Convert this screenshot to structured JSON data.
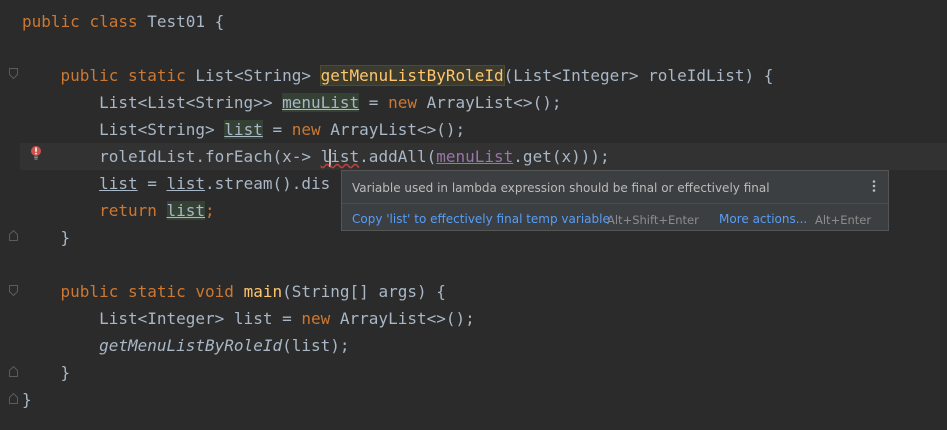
{
  "editor": {
    "lines": {
      "l1": {
        "kw1": "public",
        "kw2": "class",
        "name": "Test01 {"
      },
      "l3": {
        "kw1": "public",
        "kw2": "static",
        "ret": "List<String> ",
        "fn": "getMenuListByRoleId",
        "params": "(List<Integer> roleIdList) {"
      },
      "l4": {
        "type": "List<List<String>> ",
        "var": "menuList",
        "eq": " = ",
        "kw": "new",
        "rest": " ArrayList<>();"
      },
      "l5": {
        "type": "List<String> ",
        "var": "list",
        "eq": " = ",
        "kw": "new",
        "rest": " ArrayList<>();"
      },
      "l6": {
        "pre": "roleIdList.forEach(x-> ",
        "var_a": "l",
        "var_b": "ist",
        "mid": ".addAll(",
        "field": "menuList",
        "post": ".get(x)));"
      },
      "l7": {
        "var": "list",
        "eq": " = ",
        "var2": "list",
        "rest": ".stream().dis"
      },
      "l8": {
        "kw": "return",
        "sp": " ",
        "var": "list",
        "end": ";"
      },
      "l9": {
        "text": "}"
      },
      "l11": {
        "kw1": "public",
        "kw2": "static",
        "kw3": "void",
        "fn": "main",
        "params": "(String[] args) {"
      },
      "l12": {
        "type": "List<Integer> list = ",
        "kw": "new",
        "rest": " ArrayList<>();"
      },
      "l13": {
        "call": "getMenuListByRoleId",
        "args": "(list);"
      },
      "l14": {
        "text": "}"
      },
      "l15": {
        "text": "}"
      }
    }
  },
  "popup": {
    "message": "Variable used in lambda expression should be final or effectively final",
    "fix_label": "Copy 'list' to effectively final temp variable",
    "fix_shortcut": "Alt+Shift+Enter",
    "more_label": "More actions...",
    "more_shortcut": "Alt+Enter"
  },
  "icons": {
    "gutter_error": "bulb-error-icon",
    "fold": "fold-marker-icon",
    "menu": "kebab-menu-icon"
  },
  "colors": {
    "background": "#2b2b2b",
    "keyword": "#cc7832",
    "method": "#ffc66d",
    "text": "#a9b7c6",
    "field": "#9876aa",
    "error": "#bc3f3c",
    "link": "#589df6"
  }
}
